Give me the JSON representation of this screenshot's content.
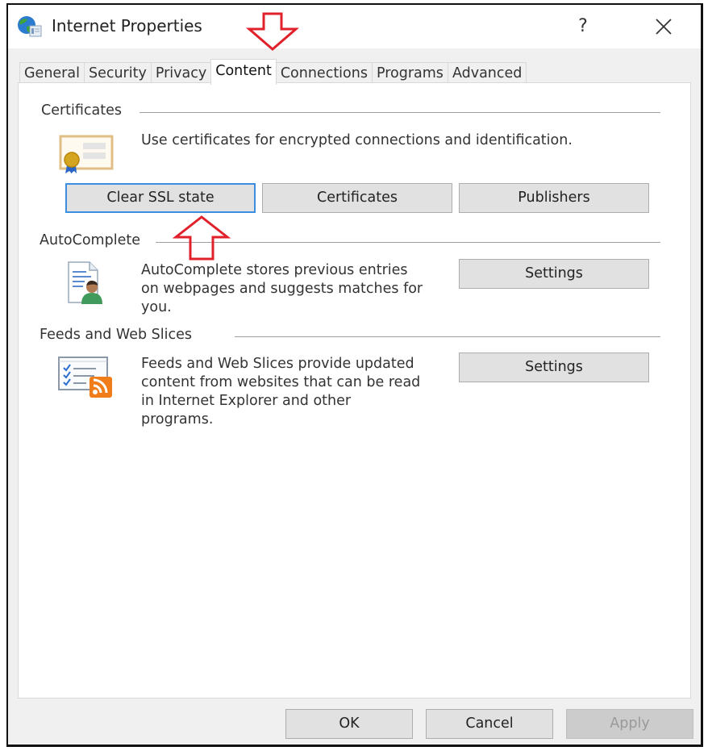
{
  "window": {
    "title": "Internet Properties",
    "help_label": "?",
    "icons": {
      "app": "internet-explorer-globe-icon",
      "close": "close-icon"
    }
  },
  "tabs": [
    {
      "label": "General",
      "active": false
    },
    {
      "label": "Security",
      "active": false
    },
    {
      "label": "Privacy",
      "active": false
    },
    {
      "label": "Content",
      "active": true
    },
    {
      "label": "Connections",
      "active": false
    },
    {
      "label": "Programs",
      "active": false
    },
    {
      "label": "Advanced",
      "active": false
    }
  ],
  "sections": {
    "certificates": {
      "title": "Certificates",
      "description": "Use certificates for encrypted connections and identification.",
      "icon": "certificate-icon",
      "buttons": {
        "clear_ssl": "Clear SSL state",
        "certificates": "Certificates",
        "publishers": "Publishers"
      }
    },
    "autocomplete": {
      "title": "AutoComplete",
      "description_lines": [
        "AutoComplete stores previous entries",
        "on webpages and suggests matches for",
        "you."
      ],
      "icon": "autocomplete-user-document-icon",
      "settings_label": "Settings"
    },
    "feeds": {
      "title": "Feeds and Web Slices",
      "description_lines": [
        "Feeds and Web Slices provide updated",
        "content from websites that can be read",
        "in Internet Explorer and other",
        "programs."
      ],
      "icon": "feeds-rss-icon",
      "settings_label": "Settings"
    }
  },
  "footer": {
    "ok": "OK",
    "cancel": "Cancel",
    "apply": "Apply",
    "apply_enabled": false
  },
  "annotations": {
    "arrow_color": "#e0202a",
    "arrows": [
      "down-arrow pointing at Content tab",
      "up-arrow pointing at Clear SSL state button"
    ]
  },
  "colors": {
    "focus_border": "#3c8ee0",
    "button_bg": "#e1e1e1",
    "dialog_bg": "#f0f0f0",
    "rss_orange": "#f07d1a"
  }
}
